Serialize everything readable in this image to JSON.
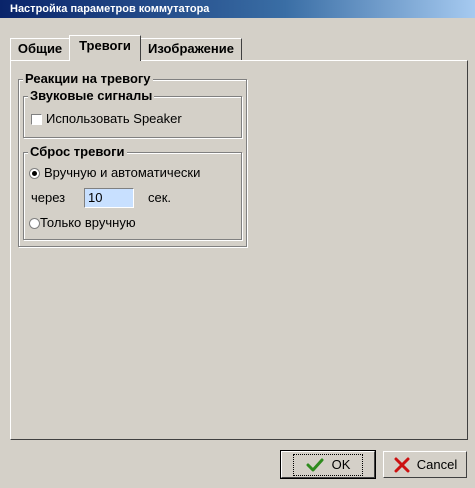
{
  "window": {
    "title": "Настройка параметров коммутатора"
  },
  "tabs": [
    {
      "label": "Общие",
      "active": false
    },
    {
      "label": "Тревоги",
      "active": true
    },
    {
      "label": "Изображение",
      "active": false
    }
  ],
  "alarm_reactions": {
    "title": "Реакции на тревогу",
    "sound": {
      "title": "Звуковые сигналы",
      "use_speaker_label": "Использовать Speaker",
      "use_speaker_checked": false
    },
    "reset": {
      "title": "Сброс тревоги",
      "manual_auto_label": "Вручную и автоматически",
      "manual_auto_selected": true,
      "after_label": "через",
      "after_value": "10",
      "unit_label": "сек.",
      "manual_only_label": "Только вручную",
      "manual_only_selected": false
    }
  },
  "buttons": {
    "ok_label": "OK",
    "cancel_label": "Cancel"
  },
  "colors": {
    "title_bar_start": "#0a246a",
    "title_bar_end": "#a6caf0",
    "window_bg": "#d4d0c8",
    "input_bg": "#c8e0ff",
    "ok_icon": "#2e8b1e",
    "cancel_icon": "#cc1111"
  },
  "icons": {
    "ok": "checkmark-icon",
    "cancel": "x-mark-icon"
  }
}
